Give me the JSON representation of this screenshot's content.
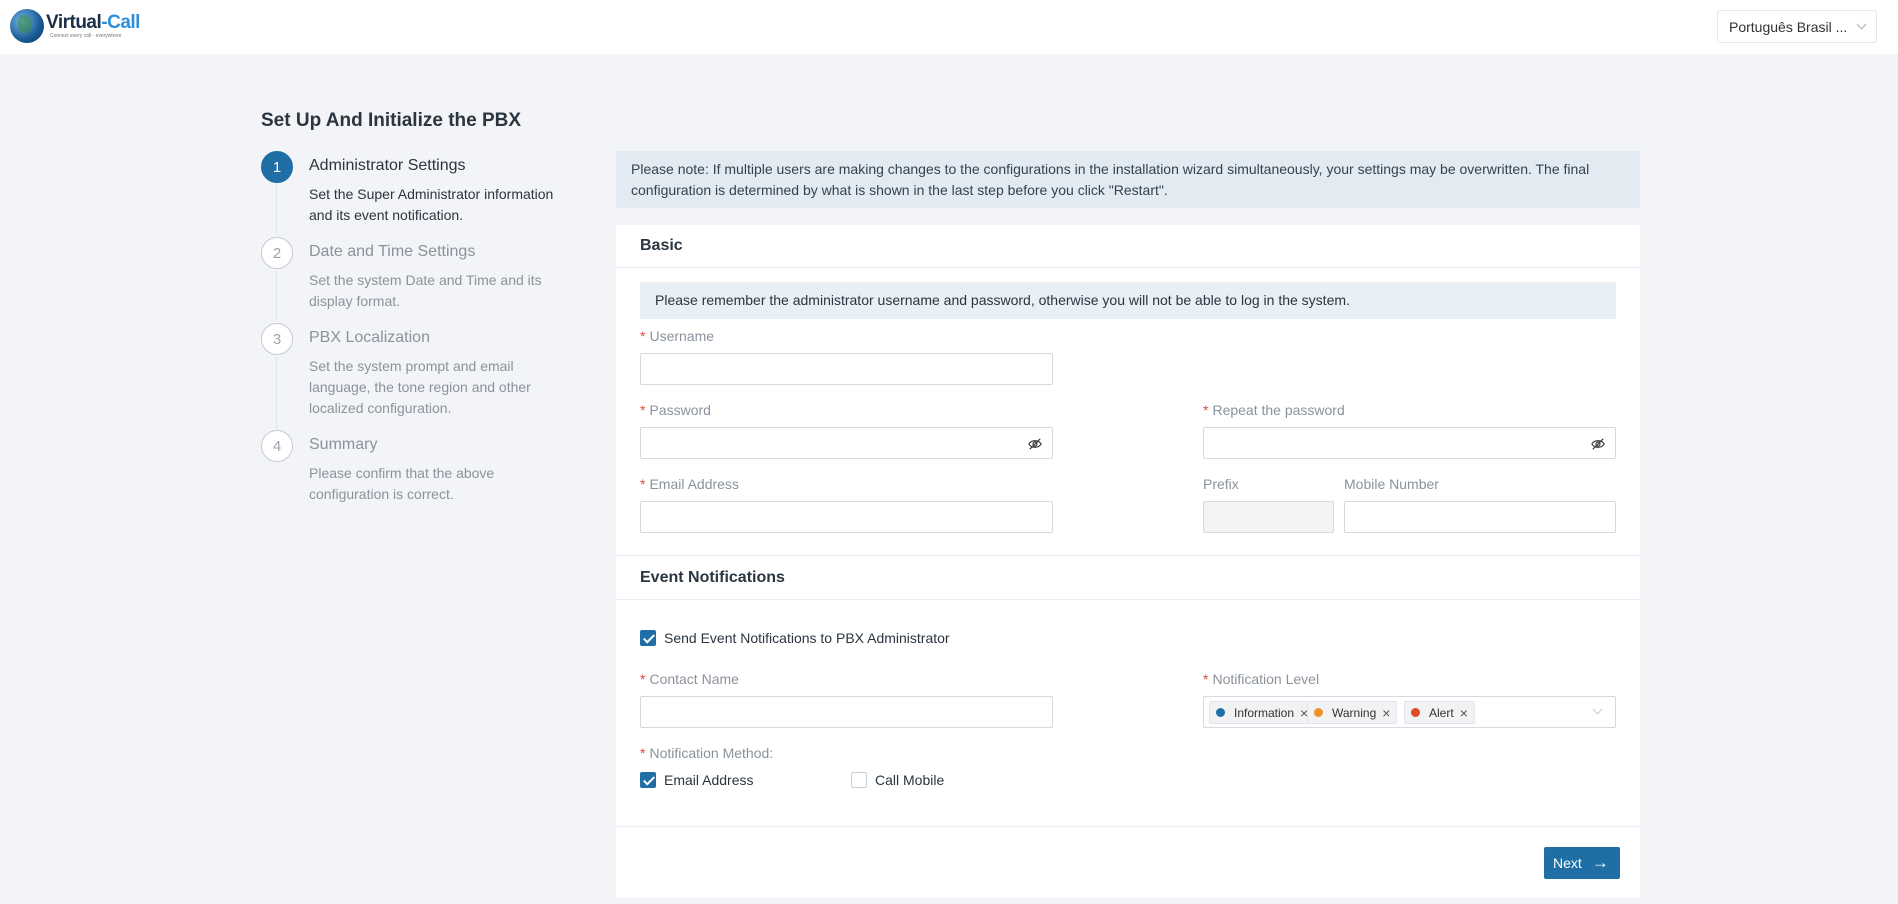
{
  "header": {
    "logo_text_a": "Virtual",
    "logo_text_b": "-Call",
    "logo_tagline": "Connect every call · everywhere",
    "language": "Português Brasil ..."
  },
  "page": {
    "title": "Set Up And Initialize the PBX"
  },
  "steps": [
    {
      "number": "1",
      "title": "Administrator Settings",
      "desc": "Set the Super Administrator information and its event notification.",
      "active": true
    },
    {
      "number": "2",
      "title": "Date and Time Settings",
      "desc": "Set the system Date and Time and its display format.",
      "active": false
    },
    {
      "number": "3",
      "title": "PBX Localization",
      "desc": "Set the system prompt and email language, the tone region and other localized configuration.",
      "active": false
    },
    {
      "number": "4",
      "title": "Summary",
      "desc": "Please confirm that the above configuration is correct.",
      "active": false
    }
  ],
  "notice": "Please note: If multiple users are making changes to the configurations in the installation wizard simultaneously, your settings may be overwritten. The final configuration is determined by what is shown in the last step before you click \"Restart\".",
  "basic": {
    "heading": "Basic",
    "hint": "Please remember the administrator username and password, otherwise you will not be able to log in the system.",
    "username_label": "Username",
    "password_label": "Password",
    "repeat_label": "Repeat the password",
    "email_label": "Email Address",
    "prefix_label": "Prefix",
    "mobile_label": "Mobile Number",
    "required_mark": "*"
  },
  "events": {
    "heading": "Event Notifications",
    "send_label": "Send Event Notifications to PBX Administrator",
    "send_checked": true,
    "contact_label": "Contact Name",
    "level_label": "Notification Level",
    "levels": [
      {
        "label": "Information",
        "color": "#1f6fa6"
      },
      {
        "label": "Warning",
        "color": "#f0912b"
      },
      {
        "label": "Alert",
        "color": "#e04a2a"
      }
    ],
    "tag_close": "×",
    "method_label": "Notification Method",
    "method_colon": ":",
    "method_email": "Email Address",
    "method_email_checked": true,
    "method_call": "Call Mobile",
    "method_call_checked": false
  },
  "footer": {
    "next_label": "Next",
    "next_arrow": "→"
  }
}
